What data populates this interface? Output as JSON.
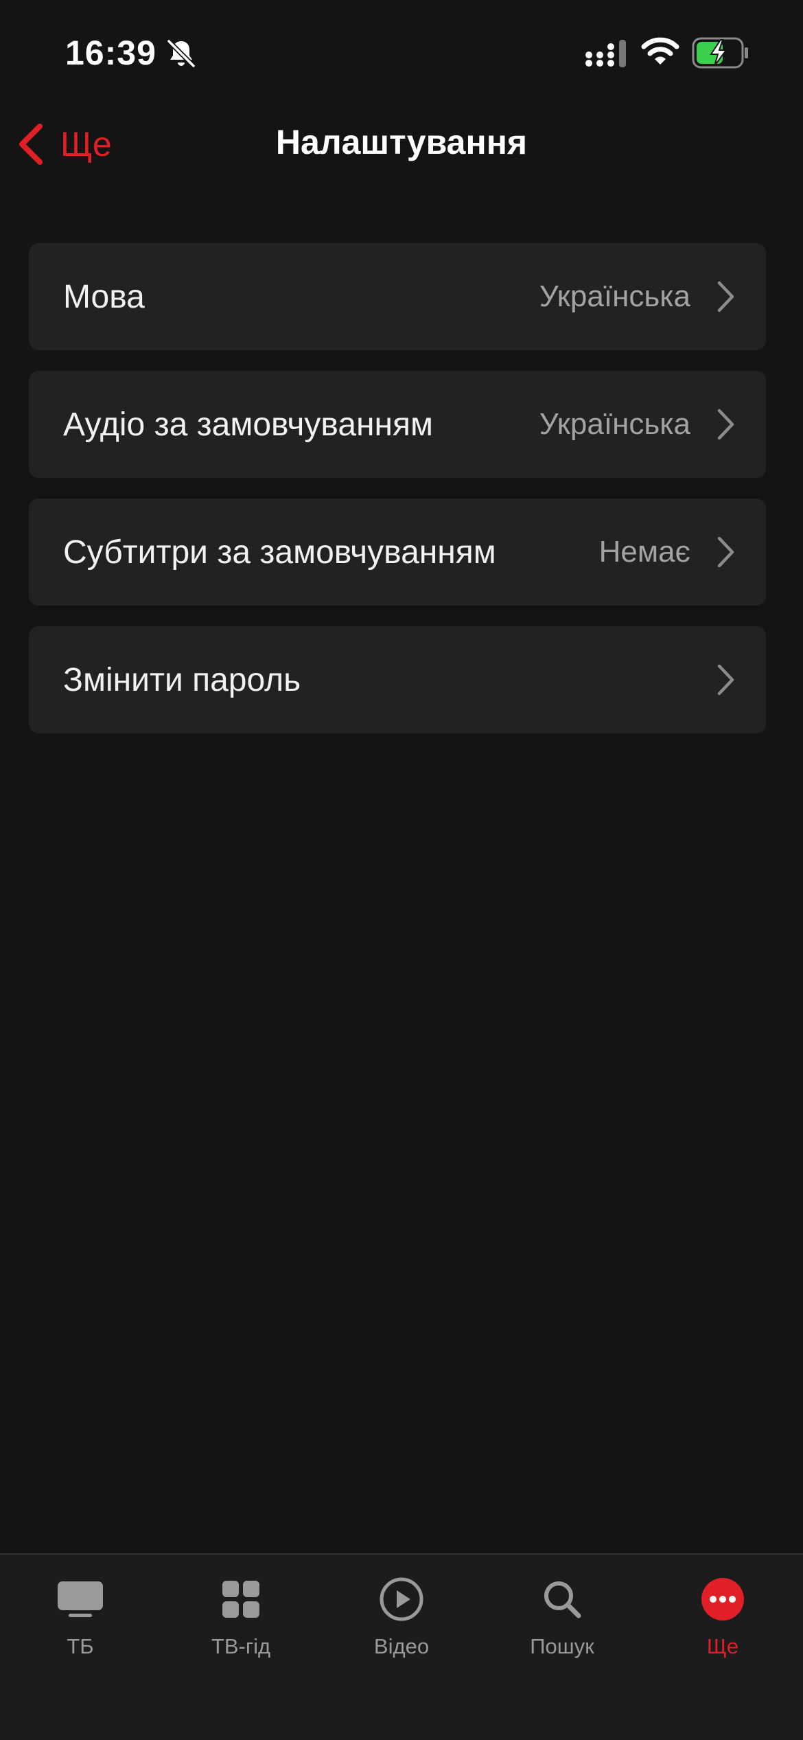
{
  "status_bar": {
    "time": "16:39"
  },
  "header": {
    "back_label": "Ще",
    "title": "Налаштування"
  },
  "settings": {
    "items": [
      {
        "label": "Мова",
        "value": "Українська"
      },
      {
        "label": "Аудіо за замовчуванням",
        "value": "Українська"
      },
      {
        "label": "Субтитри за замовчуванням",
        "value": "Немає"
      },
      {
        "label": "Змінити пароль",
        "value": ""
      }
    ]
  },
  "tab_bar": {
    "items": [
      {
        "label": "ТБ",
        "icon": "tv-icon"
      },
      {
        "label": "ТВ-гід",
        "icon": "grid-icon"
      },
      {
        "label": "Відео",
        "icon": "play-icon"
      },
      {
        "label": "Пошук",
        "icon": "search-icon"
      },
      {
        "label": "Ще",
        "icon": "more-icon"
      }
    ],
    "active_index": 4
  },
  "colors": {
    "accent": "#e01f26",
    "background": "#141414",
    "row_background": "#222222",
    "tab_inactive": "#9a9a9a",
    "battery_fill": "#3ccf4e"
  }
}
